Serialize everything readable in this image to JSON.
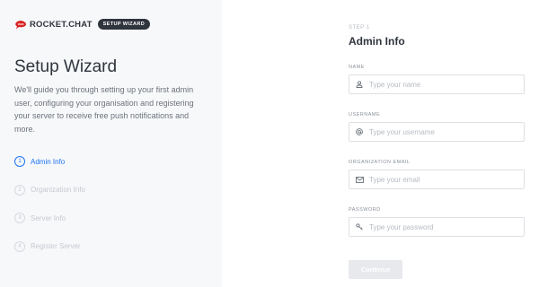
{
  "brand": {
    "name": "ROCKET.CHAT",
    "tag": "SETUP WIZARD",
    "color": "#db2323"
  },
  "sidebar": {
    "title": "Setup Wizard",
    "description": "We'll guide you through setting up your first admin user, configuring your organisation and registering your server to receive free push notifications and more.",
    "steps": [
      {
        "number": "1",
        "label": "Admin Info",
        "active": true
      },
      {
        "number": "2",
        "label": "Organization Info",
        "active": false
      },
      {
        "number": "3",
        "label": "Server Info",
        "active": false
      },
      {
        "number": "4",
        "label": "Register Server",
        "active": false
      }
    ]
  },
  "form": {
    "step_hint": "STEP 1",
    "title": "Admin Info",
    "fields": [
      {
        "label": "NAME",
        "placeholder": "Type your name",
        "value": "",
        "icon": "user-icon"
      },
      {
        "label": "USERNAME",
        "placeholder": "Type your username",
        "value": "",
        "icon": "at-icon"
      },
      {
        "label": "ORGANIZATION EMAIL",
        "placeholder": "Type your email",
        "value": "",
        "icon": "mail-icon"
      },
      {
        "label": "PASSWORD",
        "placeholder": "Type your password",
        "value": "",
        "icon": "key-icon"
      }
    ],
    "continue_label": "Continue"
  },
  "colors": {
    "accent": "#1d74f5",
    "text": "#2f343d",
    "muted": "#6c727a"
  }
}
